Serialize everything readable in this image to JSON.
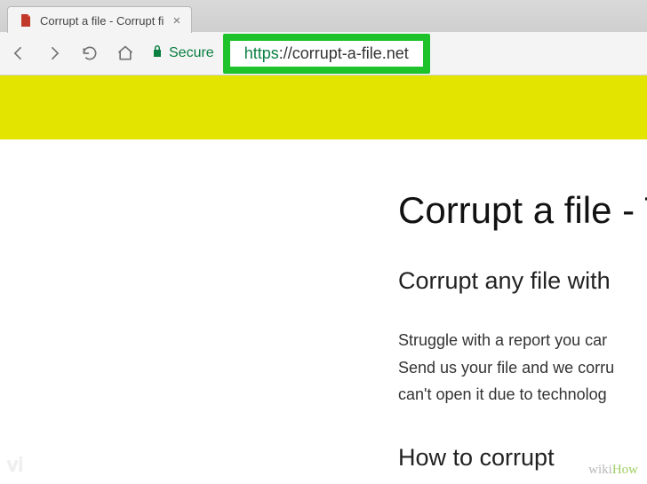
{
  "browser": {
    "tab": {
      "title": "Corrupt a file - Corrupt fi",
      "favicon_name": "document-icon"
    },
    "secure_label": "Secure",
    "url_scheme": "https",
    "url_rest": "://corrupt-a-file.net"
  },
  "page": {
    "h1": "Corrupt a file - T",
    "h2": "Corrupt any file with",
    "p1": "Struggle with a report you car",
    "p2": "Send us your file and we corru",
    "p3": "can't open it due to technolog",
    "h3": "How to corrupt"
  },
  "watermark": {
    "w": "wiki",
    "h": "How"
  },
  "branding": "vi"
}
